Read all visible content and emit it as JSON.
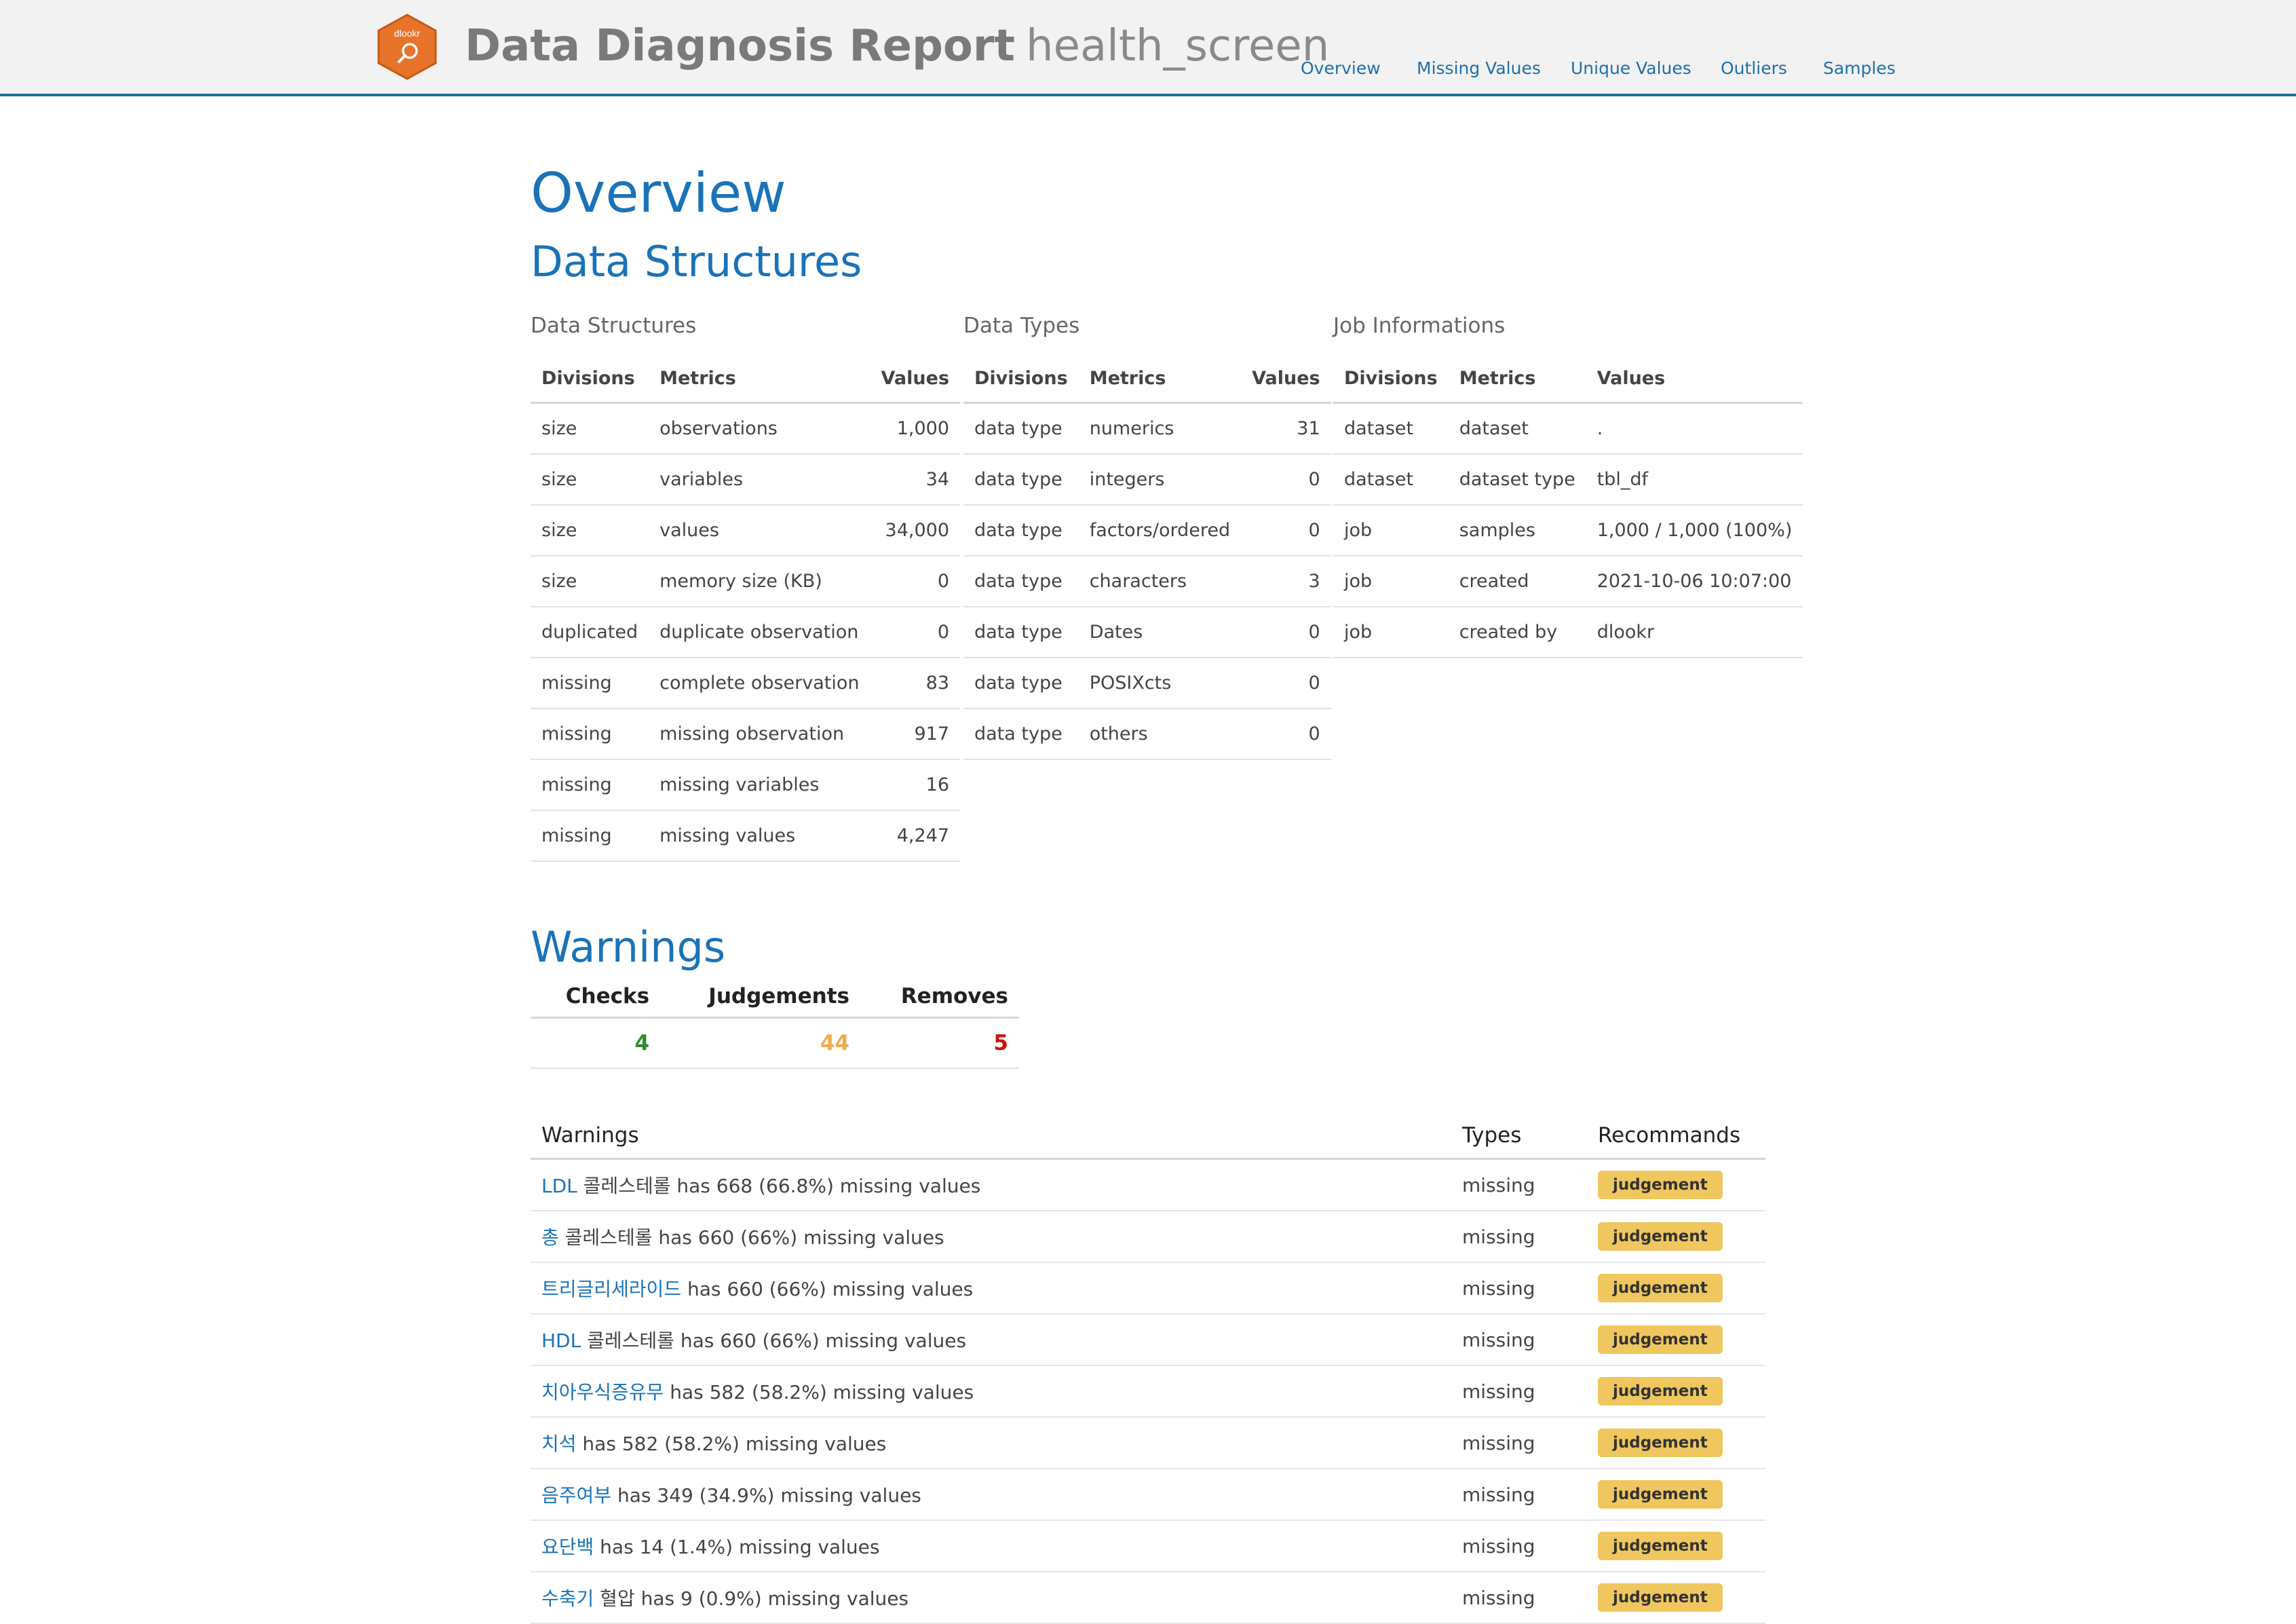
{
  "header": {
    "logo_text": "dlookr",
    "title": "Data Diagnosis Report",
    "subtitle": "health_screen",
    "nav": [
      "Overview",
      "Missing Values",
      "Unique Values",
      "Outliers",
      "Samples"
    ]
  },
  "overview": {
    "heading": "Overview",
    "subheading": "Data Structures"
  },
  "data_structures": {
    "caption": "Data Structures",
    "headers": [
      "Divisions",
      "Metrics",
      "Values"
    ],
    "rows": [
      [
        "size",
        "observations",
        "1,000"
      ],
      [
        "size",
        "variables",
        "34"
      ],
      [
        "size",
        "values",
        "34,000"
      ],
      [
        "size",
        "memory size (KB)",
        "0"
      ],
      [
        "duplicated",
        "duplicate observation",
        "0"
      ],
      [
        "missing",
        "complete observation",
        "83"
      ],
      [
        "missing",
        "missing observation",
        "917"
      ],
      [
        "missing",
        "missing variables",
        "16"
      ],
      [
        "missing",
        "missing values",
        "4,247"
      ]
    ]
  },
  "data_types": {
    "caption": "Data Types",
    "headers": [
      "Divisions",
      "Metrics",
      "Values"
    ],
    "rows": [
      [
        "data type",
        "numerics",
        "31"
      ],
      [
        "data type",
        "integers",
        "0"
      ],
      [
        "data type",
        "factors/ordered",
        "0"
      ],
      [
        "data type",
        "characters",
        "3"
      ],
      [
        "data type",
        "Dates",
        "0"
      ],
      [
        "data type",
        "POSIXcts",
        "0"
      ],
      [
        "data type",
        "others",
        "0"
      ]
    ]
  },
  "job_info": {
    "caption": "Job Informations",
    "headers": [
      "Divisions",
      "Metrics",
      "Values"
    ],
    "rows": [
      [
        "dataset",
        "dataset",
        "."
      ],
      [
        "dataset",
        "dataset type",
        "tbl_df"
      ],
      [
        "job",
        "samples",
        "1,000 / 1,000 (100%)"
      ],
      [
        "job",
        "created",
        "2021-10-06 10:07:00"
      ],
      [
        "job",
        "created by",
        "dlookr"
      ]
    ]
  },
  "warnings_summary": {
    "heading": "Warnings",
    "headers": [
      "Checks",
      "Judgements",
      "Removes"
    ],
    "values": [
      "4",
      "44",
      "5"
    ],
    "colors": [
      "#2e8b2e",
      "#f0ad4e",
      "#cc1111"
    ]
  },
  "warnings_list": {
    "headers": [
      "Warnings",
      "Types",
      "Recommands"
    ],
    "rows": [
      {
        "var": "LDL",
        "text": " 콜레스테롤 has 668 (66.8%) missing values",
        "type": "missing",
        "rec": "judgement"
      },
      {
        "var": "총",
        "text": " 콜레스테롤 has 660 (66%) missing values",
        "type": "missing",
        "rec": "judgement"
      },
      {
        "var": "트리글리세라이드",
        "text": " has 660 (66%) missing values",
        "type": "missing",
        "rec": "judgement"
      },
      {
        "var": "HDL",
        "text": " 콜레스테롤 has 660 (66%) missing values",
        "type": "missing",
        "rec": "judgement"
      },
      {
        "var": "치아우식증유무",
        "text": " has 582 (58.2%) missing values",
        "type": "missing",
        "rec": "judgement"
      },
      {
        "var": "치석",
        "text": " has 582 (58.2%) missing values",
        "type": "missing",
        "rec": "judgement"
      },
      {
        "var": "음주여부",
        "text": " has 349 (34.9%) missing values",
        "type": "missing",
        "rec": "judgement"
      },
      {
        "var": "요단백",
        "text": " has 14 (1.4%) missing values",
        "type": "missing",
        "rec": "judgement"
      },
      {
        "var": "수축기",
        "text": " 혈압 has 9 (0.9%) missing values",
        "type": "missing",
        "rec": "judgement"
      }
    ]
  }
}
